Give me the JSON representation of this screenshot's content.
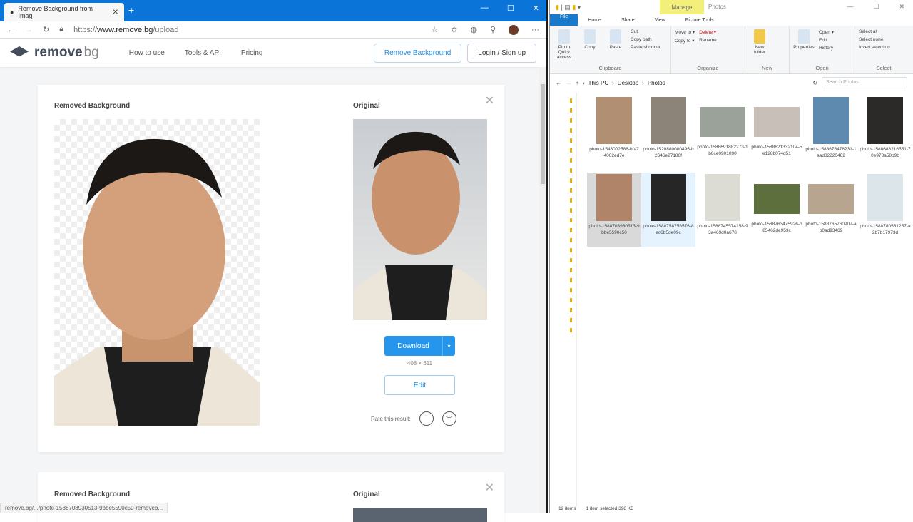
{
  "browser": {
    "tab_title": "Remove Background from Imag",
    "url_prefix": "https://",
    "url_domain": "www.remove.bg",
    "url_path": "/upload",
    "status_url": "remove.bg/.../photo-1588708930513-9bbe5590c50-removeb..."
  },
  "site": {
    "logo_main": "remove",
    "logo_accent": "bg",
    "nav": [
      "How to use",
      "Tools & API",
      "Pricing"
    ],
    "remove_btn": "Remove Background",
    "login_btn": "Login / Sign up"
  },
  "result": {
    "removed_label": "Removed Background",
    "original_label": "Original",
    "download": "Download",
    "dims": "408 × 611",
    "edit": "Edit",
    "rate": "Rate this result:"
  },
  "result2": {
    "removed_label": "Removed Background",
    "original_label": "Original"
  },
  "explorer": {
    "manage": "Manage",
    "title": "Photos",
    "tabs": [
      "File",
      "Home",
      "Share",
      "View",
      "Picture Tools"
    ],
    "clipboard": {
      "pin": "Pin to Quick access",
      "copy": "Copy",
      "paste": "Paste",
      "cut": "Cut",
      "copy_path": "Copy path",
      "paste_shortcut": "Paste shortcut",
      "name": "Clipboard"
    },
    "organize": {
      "move": "Move to ▾",
      "delete": "Delete ▾",
      "copy": "Copy to ▾",
      "rename": "Rename",
      "name": "Organize"
    },
    "new": {
      "folder": "New folder",
      "name": "New"
    },
    "open": {
      "properties": "Properties",
      "open": "Open ▾",
      "edit": "Edit",
      "history": "History",
      "name": "Open"
    },
    "select": {
      "all": "Select all",
      "none": "Select none",
      "invert": "Invert selection",
      "name": "Select"
    },
    "crumbs": [
      "This PC",
      "Desktop",
      "Photos"
    ],
    "search_placeholder": "Search Photos",
    "files": [
      {
        "name": "photo-1543002588-bfa74002ed7e",
        "color": "#b08f72"
      },
      {
        "name": "photo-1520880000495-b2646e27186f",
        "color": "#8c8478"
      },
      {
        "name": "photo-1588691882273-1b8ce0901090",
        "color": "#9aa29a"
      },
      {
        "name": "photo-1588621332104-5e128b074d51",
        "color": "#c8c0b8"
      },
      {
        "name": "photo-1588676478231-1aad82220462",
        "color": "#5f8ab0"
      },
      {
        "name": "photo-1588688216551-70e978a58b9b",
        "color": "#2c2a28"
      },
      {
        "name": "photo-1588708930513-9bbe5590c50",
        "color": "#b08468"
      },
      {
        "name": "photo-1588758758576-8ec6b5de09c",
        "color": "#262626"
      },
      {
        "name": "photo-1588745574158-93a469d0a678",
        "color": "#dcdcd4"
      },
      {
        "name": "photo-1588763475926-b85462de953c",
        "color": "#5d6f3d"
      },
      {
        "name": "photo-1588765760907-ab0ad93469",
        "color": "#b8a590"
      },
      {
        "name": "photo-1588780531257-a2b7b17973d",
        "color": "#dbe5ea"
      }
    ],
    "status_items": "12 items",
    "status_selected": "1 item selected  398 KB"
  }
}
